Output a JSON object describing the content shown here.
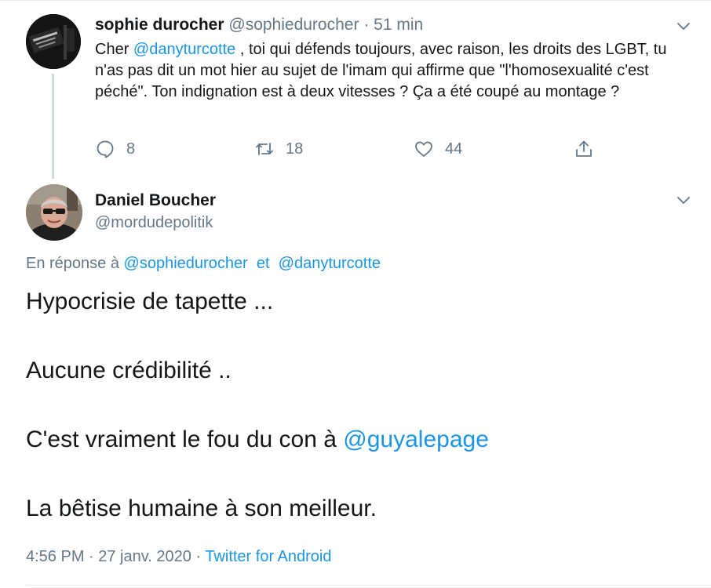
{
  "tweet1": {
    "name": "sophie durocher",
    "handle": "@sophiedurocher",
    "separator": "·",
    "time": "51 min",
    "text_before": "Cher ",
    "mention": "@danyturcotte",
    "text_after": " , toi qui défends toujours, avec raison,  les droits des LGBT, tu n'as pas dit un mot hier au sujet de l'imam qui affirme que \"l'homosexualité c'est péché\". Ton indignation est à deux vitesses ? Ça a été coupé au montage ?",
    "actions": {
      "reply_count": "8",
      "retweet_count": "18",
      "like_count": "44"
    },
    "icons": [
      "reply-icon",
      "retweet-icon",
      "like-icon",
      "share-icon",
      "chevron-down-icon"
    ]
  },
  "tweet2": {
    "name": "Daniel Boucher",
    "handle": "@mordudepolitik",
    "reply_prefix": "En réponse à",
    "reply_mention1": "@sophiedurocher",
    "reply_and": "et",
    "reply_mention2": "@danyturcotte",
    "body": {
      "line1": "Hypocrisie de tapette ...",
      "line2": "Aucune crédibilité ..",
      "line3_text": "C'est vraiment le fou du con à ",
      "line3_mention": "@guyalepage",
      "line4": "La bêtise humaine à son meilleur."
    },
    "timestamp": "4:56 PM · 27 janv. 2020",
    "meta_separator": "·",
    "source": "Twitter for Android"
  },
  "colors": {
    "link": "#1b95e0",
    "secondary_text": "#657786",
    "primary_text": "#14171a",
    "divider": "#e6ecf0"
  }
}
